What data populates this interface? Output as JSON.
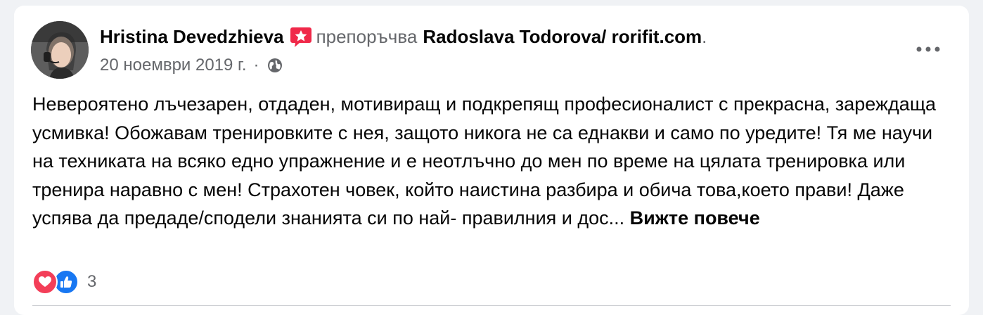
{
  "post": {
    "author": "Hristina Devedzhieva",
    "action": "препоръчва",
    "page": "Radoslava Todorova/ rorifit.com",
    "period": ".",
    "date": "20 ноември 2019 г.",
    "separator": "·",
    "audience_icon": "globe-icon",
    "more_icon": "more-horizontal-icon",
    "text": "Невероятено лъчезарен, отдаден, мотивиращ и подкрепящ професионалист с прекрасна, зареждаща усмивка! Обожавам тренировките с нея, защото никога не са еднакви и само по уредите! Тя ме научи на техниката на всяко едно упражнение и е неотлъчно до мен по време на цялата тренировка или тренира наравно с мен!  Страхотен човек, който наистина разбира и обича това,което прави! Даже успява да предаде/сподели знанията си по най- правилния и дос... ",
    "see_more": "Вижте повече"
  },
  "reactions": {
    "icons": [
      "love-icon",
      "like-icon"
    ],
    "count": "3"
  },
  "colors": {
    "love": "#f33e58",
    "like": "#1877f2",
    "badge": "#f02849",
    "secondary_text": "#65676b"
  }
}
